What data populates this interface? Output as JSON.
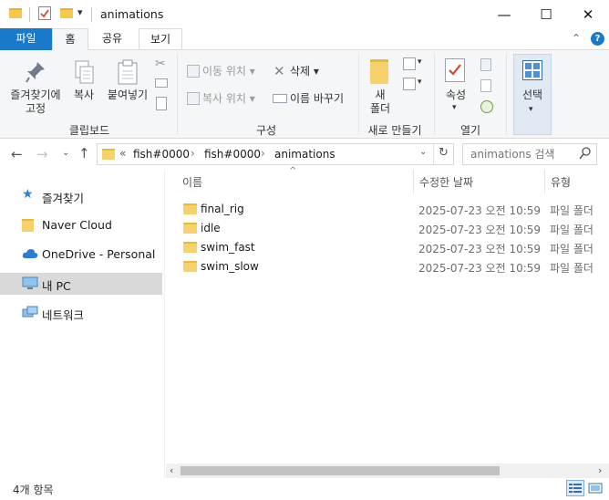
{
  "window": {
    "title": "animations",
    "minimize": "—",
    "maximize": "☐",
    "close": "✕"
  },
  "tabs": [
    {
      "label": "파일"
    },
    {
      "label": "홈"
    },
    {
      "label": "공유"
    },
    {
      "label": "보기"
    }
  ],
  "ribbon": {
    "clipboard": {
      "pin_label_1": "즐겨찾기에",
      "pin_label_2": "고정",
      "copy": "복사",
      "paste": "붙여넣기",
      "group": "클립보드"
    },
    "organize": {
      "move_to": "이동 위치",
      "copy_to": "복사 위치",
      "delete": "삭제",
      "rename": "이름 바꾸기",
      "group": "구성"
    },
    "new": {
      "new_folder_1": "새",
      "new_folder_2": "폴더",
      "group": "새로 만들기"
    },
    "open": {
      "properties": "속성",
      "group": "열기"
    },
    "select": {
      "label": "선택"
    }
  },
  "address": {
    "overflow": "«",
    "crumbs": [
      "fish#0000",
      "fish#0000",
      "animations"
    ],
    "search_placeholder": "animations 검색"
  },
  "nav": {
    "items": [
      {
        "label": "즐겨찾기"
      },
      {
        "label": "Naver Cloud"
      },
      {
        "label": "OneDrive - Personal"
      },
      {
        "label": "내 PC"
      },
      {
        "label": "네트워크"
      }
    ]
  },
  "columns": {
    "name": "이름",
    "modified": "수정한 날짜",
    "type": "유형"
  },
  "files": [
    {
      "name": "final_rig",
      "modified": "2025-07-23 오전 10:59",
      "type": "파일 폴더"
    },
    {
      "name": "idle",
      "modified": "2025-07-23 오전 10:59",
      "type": "파일 폴더"
    },
    {
      "name": "swim_fast",
      "modified": "2025-07-23 오전 10:59",
      "type": "파일 폴더"
    },
    {
      "name": "swim_slow",
      "modified": "2025-07-23 오전 10:59",
      "type": "파일 폴더"
    }
  ],
  "status": {
    "item_count": "4개 항목"
  },
  "colors": {
    "accent": "#1979ca",
    "folder": "#f7d26a",
    "selection": "#d9d9d9"
  }
}
